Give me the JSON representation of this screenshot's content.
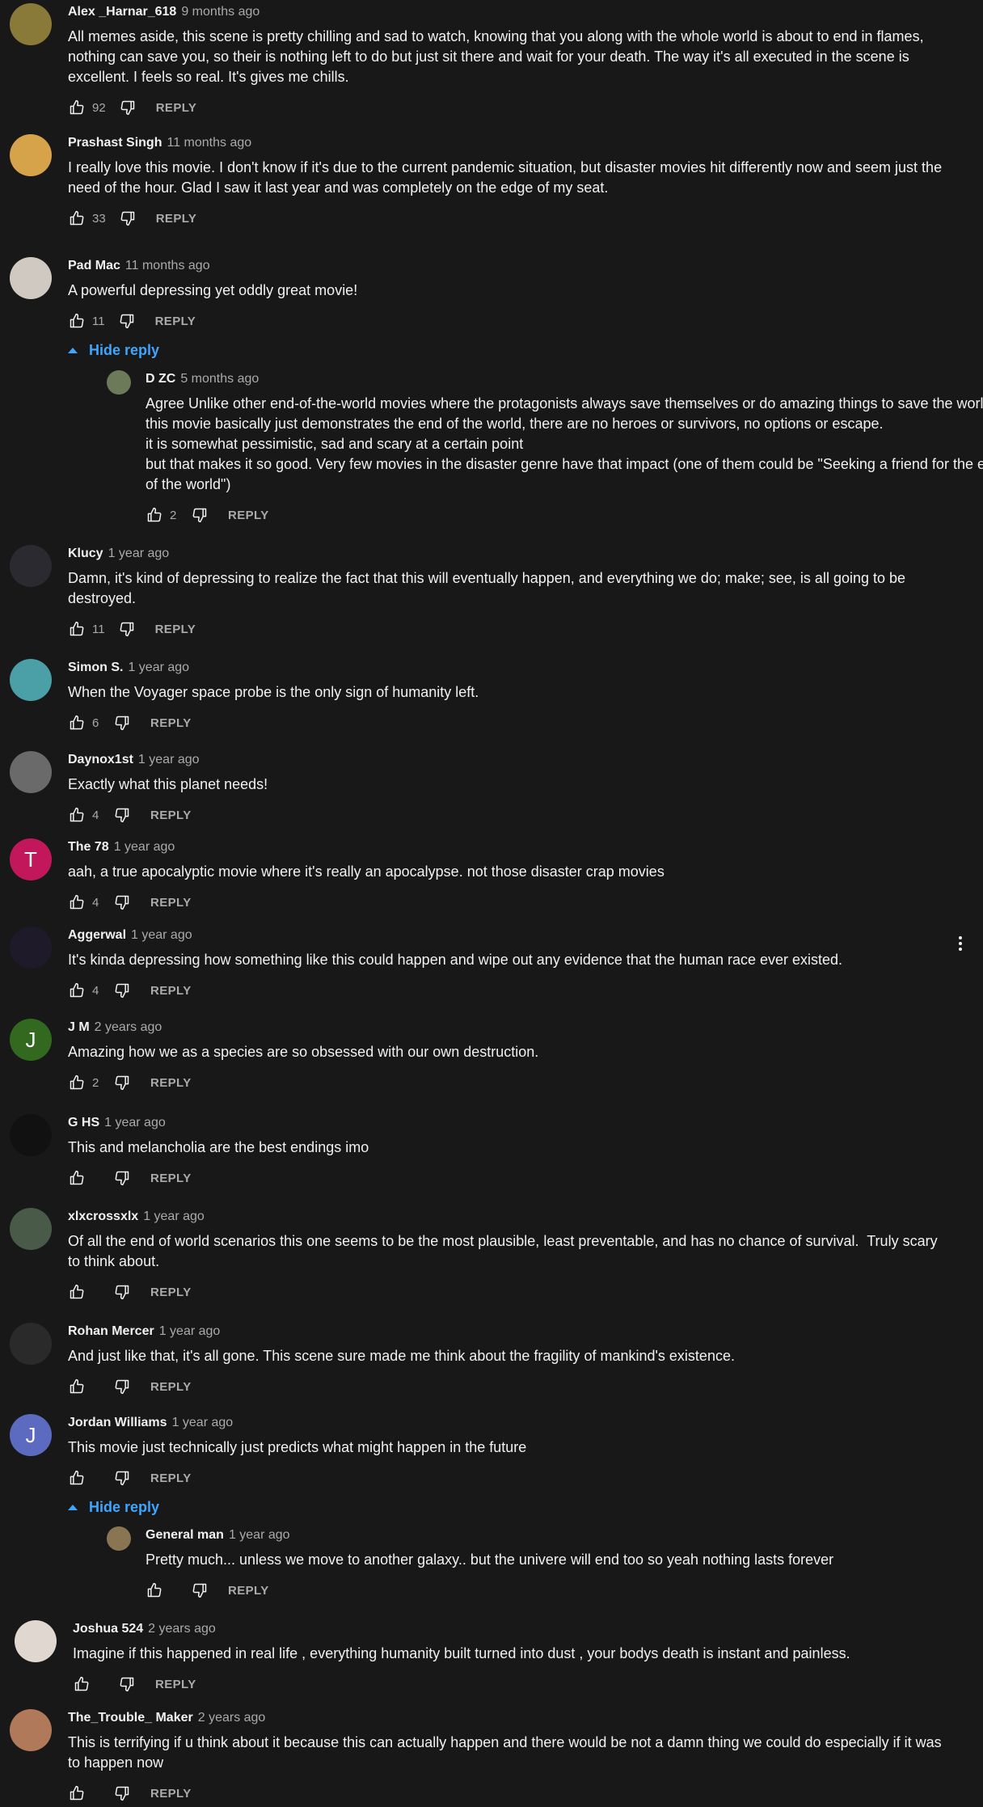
{
  "colors": {
    "background": "#181818",
    "link": "#3ea6ff",
    "muted": "#aaaaaa",
    "text": "#f1f1f1"
  },
  "reply_label": "REPLY",
  "hide_reply_label": "Hide reply",
  "comments": [
    {
      "author": "Alex _Harnar_618",
      "time": "9 months ago",
      "text": "All memes aside, this scene is pretty chilling and sad to watch, knowing that you along with the whole world is about to end in flames, nothing can save you, so their is nothing left to do but just sit there and wait for your death. The way it's all executed in the scene is excellent. I feels so real. It's gives me chills.",
      "likes": "92",
      "avatar_color": "#8a7a3a",
      "avatar_letter": ""
    },
    {
      "author": "Prashast Singh",
      "time": "11 months ago",
      "text": "I really love this movie. I don't know if it's due to the current pandemic situation, but disaster movies hit differently now and seem just the need of the hour. Glad I saw it last year and was completely on the edge of my seat.",
      "likes": "33",
      "avatar_color": "#d6a24a",
      "avatar_letter": ""
    },
    {
      "author": "Pad Mac",
      "time": "11 months ago",
      "text": "A powerful depressing yet oddly great movie!",
      "likes": "11",
      "avatar_color": "#cfc9c2",
      "avatar_letter": ""
    },
    {
      "author": "D ZC",
      "time": "5 months ago",
      "text": "Agree Unlike other end-of-the-world movies where the protagonists always save themselves or do amazing things to save the world, this movie basically just demonstrates the end of the world, there are no heroes or survivors, no options or escape.\nit is somewhat pessimistic, sad and scary at a certain point\nbut that makes it so good. Very few movies in the disaster genre have that impact (one of them could be \"Seeking a friend for the end of the world\")",
      "likes": "2",
      "avatar_color": "#6d7a5a",
      "avatar_letter": ""
    },
    {
      "author": "Klucy",
      "time": "1 year ago",
      "text": "Damn, it's kind of depressing to realize the fact that this will eventually happen, and everything we do; make; see, is all going to be destroyed.",
      "likes": "11",
      "avatar_color": "#2a2a30",
      "avatar_letter": ""
    },
    {
      "author": "Simon S.",
      "time": "1 year ago",
      "text": "When the Voyager space probe is the only sign of humanity left.",
      "likes": "6",
      "avatar_color": "#4aa0a6",
      "avatar_letter": ""
    },
    {
      "author": "Daynox1st",
      "time": "1 year ago",
      "text": "Exactly what this planet needs!",
      "likes": "4",
      "avatar_color": "#6a6a6a",
      "avatar_letter": ""
    },
    {
      "author": "The 78",
      "time": "1 year ago",
      "text": "aah, a true apocalyptic movie where it's really an apocalypse. not those disaster crap movies",
      "likes": "4",
      "avatar_color": "#c2185b",
      "avatar_letter": "T"
    },
    {
      "author": "Aggerwal",
      "time": "1 year ago",
      "text": "It's kinda depressing how something like this could happen and wipe out any evidence that the human race ever existed.",
      "likes": "4",
      "avatar_color": "#1e1a2a",
      "avatar_letter": ""
    },
    {
      "author": "J M",
      "time": "2 years ago",
      "text": "Amazing how we as a species are so obsessed with our own destruction.",
      "likes": "2",
      "avatar_color": "#33691e",
      "avatar_letter": "J"
    },
    {
      "author": "G HS",
      "time": "1 year ago",
      "text": "This and melancholia are the best endings imo",
      "likes": "",
      "avatar_color": "#111111",
      "avatar_letter": ""
    },
    {
      "author": "xlxcrossxlx",
      "time": "1 year ago",
      "text": "Of all the end of world scenarios this one seems to be the most plausible, least preventable, and has no chance of survival.  Truly scary to think about.",
      "likes": "",
      "avatar_color": "#4a5a48",
      "avatar_letter": ""
    },
    {
      "author": "Rohan Mercer",
      "time": "1 year ago",
      "text": "And just like that, it's all gone. This scene sure made me think about the fragility of mankind's existence.",
      "likes": "",
      "avatar_color": "#2a2a2a",
      "avatar_letter": ""
    },
    {
      "author": "Jordan Williams",
      "time": "1 year ago",
      "text": "This movie just technically just predicts what might happen in the future",
      "likes": "",
      "avatar_color": "#5c6bc0",
      "avatar_letter": "J"
    },
    {
      "author": "General man",
      "time": "1 year ago",
      "text": "Pretty much... unless we move to another galaxy.. but the univere will end too so yeah nothing lasts forever",
      "likes": "",
      "avatar_color": "#8a7552",
      "avatar_letter": ""
    },
    {
      "author": "Joshua 524",
      "time": "2 years ago",
      "text": "Imagine if this happened in real life , everything humanity built turned into dust , your bodys death is instant and painless.",
      "likes": "",
      "avatar_color": "#e0d8d0",
      "avatar_letter": ""
    },
    {
      "author": "The_Trouble_ Maker",
      "time": "2 years ago",
      "text": "This is terrifying if u think about it because this can actually happen and there would be not a damn thing we could do especially if it was to happen now",
      "likes": "",
      "avatar_color": "#b07a5a",
      "avatar_letter": ""
    }
  ]
}
